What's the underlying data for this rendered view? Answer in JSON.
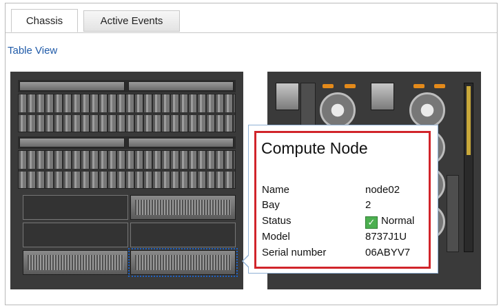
{
  "tabs": [
    {
      "label": "Chassis",
      "active": true
    },
    {
      "label": "Active Events",
      "active": false
    }
  ],
  "view_link": "Table View",
  "tooltip": {
    "title": "Compute Node",
    "fields": [
      {
        "key": "Name",
        "value": "node02"
      },
      {
        "key": "Bay",
        "value": "2"
      },
      {
        "key": "Status",
        "value": "Normal",
        "icon": "check-icon"
      },
      {
        "key": "Model",
        "value": "8737J1U"
      },
      {
        "key": "Serial number",
        "value": "06ABYV7"
      }
    ]
  },
  "colors": {
    "link": "#1f5aa8",
    "highlight_border": "#d1242a",
    "status_ok": "#4caf50",
    "selection": "#1f63c6"
  }
}
